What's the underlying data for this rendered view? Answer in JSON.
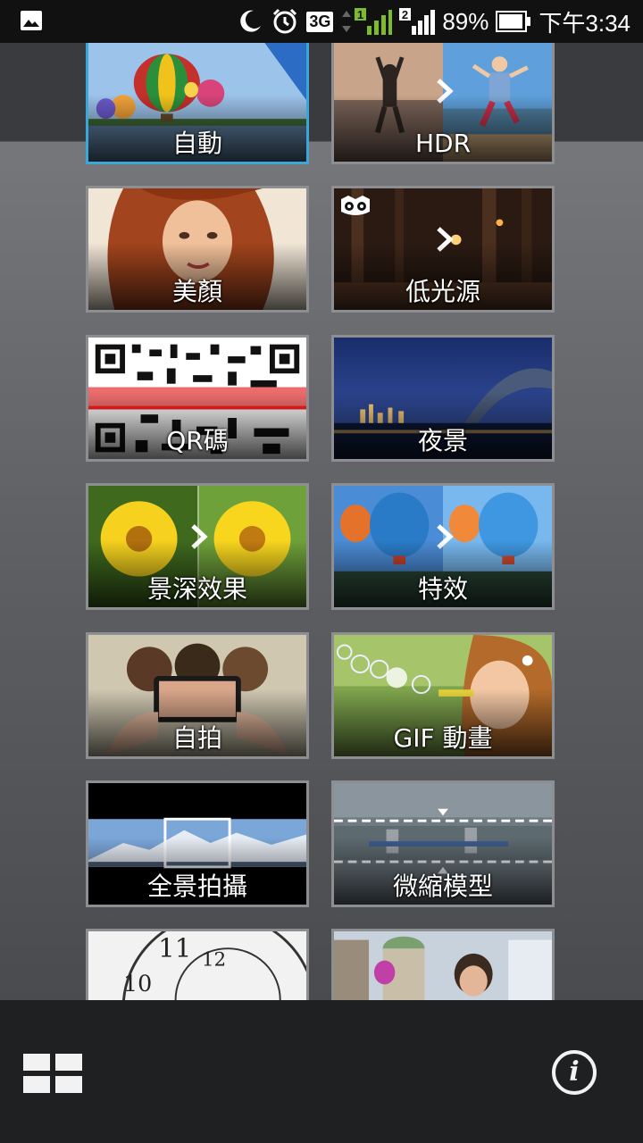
{
  "status_bar": {
    "network": "3G",
    "sim1": "1",
    "sim2": "2",
    "battery": "89%",
    "time": "下午3:34",
    "icons": [
      "gallery-icon",
      "moon-icon",
      "alarm-icon",
      "signal-icon",
      "battery-icon"
    ]
  },
  "modes": [
    {
      "label": "自動",
      "selected": true
    },
    {
      "label": "HDR"
    },
    {
      "label": "美顏"
    },
    {
      "label": "低光源"
    },
    {
      "label": "QR碼"
    },
    {
      "label": "夜景"
    },
    {
      "label": "景深效果"
    },
    {
      "label": "特效"
    },
    {
      "label": "自拍"
    },
    {
      "label": "GIF 動畫"
    },
    {
      "label": "全景拍攝"
    },
    {
      "label": "微縮模型"
    },
    {
      "label": ""
    },
    {
      "label": ""
    }
  ],
  "bottom_bar": {
    "grid_icon": "grid-view-icon",
    "info_icon": "info-icon",
    "info_glyph": "i"
  },
  "colors": {
    "selected_border": "#3aa7d6",
    "tile_border": "#8d8e91"
  }
}
